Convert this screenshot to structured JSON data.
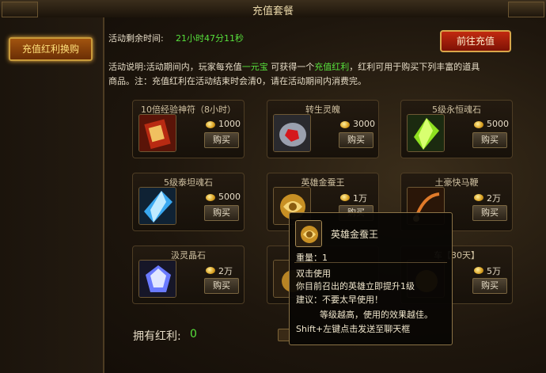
{
  "window": {
    "title": "充值套餐"
  },
  "sidebar": {
    "button_label": "充值红利换购"
  },
  "header": {
    "countdown_label": "活动剩余时间:",
    "countdown_value": "21小时47分11秒",
    "topup_button": "前往充值",
    "desc_label": "活动说明:",
    "desc_part1": "活动期间内，玩家每充值",
    "desc_highlight1": "一元宝",
    "desc_part2": "可获得一个",
    "desc_highlight2": "充值红利",
    "desc_part3": "，红利可用于购买下列丰富的道具",
    "desc_line2": "商品。注：充值红利在活动结束时会清0，请在活动期间内消费完。"
  },
  "items": [
    {
      "name": "10倍经验神符（8小时）",
      "price": "1000",
      "buy": "购买",
      "icon": "red-scroll-icon"
    },
    {
      "name": "转生灵魄",
      "price": "3000",
      "buy": "购买",
      "icon": "red-soul-stone-icon"
    },
    {
      "name": "5级永恒魂石",
      "price": "5000",
      "buy": "购买",
      "icon": "green-crystal-icon"
    },
    {
      "name": "5级泰坦魂石",
      "price": "5000",
      "buy": "购买",
      "icon": "blue-crystal-icon"
    },
    {
      "name": "英雄金蚕王",
      "price": "1万",
      "buy": "购买",
      "icon": "golden-silkworm-icon"
    },
    {
      "name": "土豪快马鞭",
      "price": "2万",
      "buy": "购买",
      "icon": "whip-icon"
    },
    {
      "name": "汲灵晶石",
      "price": "2万",
      "buy": "购买",
      "icon": "purple-gem-icon"
    },
    {
      "name": "",
      "price": "",
      "buy": "",
      "icon": "hidden-item-icon"
    },
    {
      "name": "车【30天】",
      "price": "5万",
      "buy": "购买",
      "icon": "hidden-item-icon"
    }
  ],
  "footer": {
    "bonus_label": "拥有红利:",
    "bonus_value": "0"
  },
  "tooltip": {
    "name": "英雄金蚕王",
    "weight": "重量：1",
    "usage": "双击使用",
    "effect": "你目前召出的英雄立即提升1级",
    "advice": "建议：不要太早使用！",
    "advice2": "等级越高，使用的效果越佳。",
    "hint": "Shift+左键点击发送至聊天框"
  },
  "colors": {
    "green": "#57e03c",
    "yellow": "#f2d44a",
    "accent": "#c89a3a"
  }
}
